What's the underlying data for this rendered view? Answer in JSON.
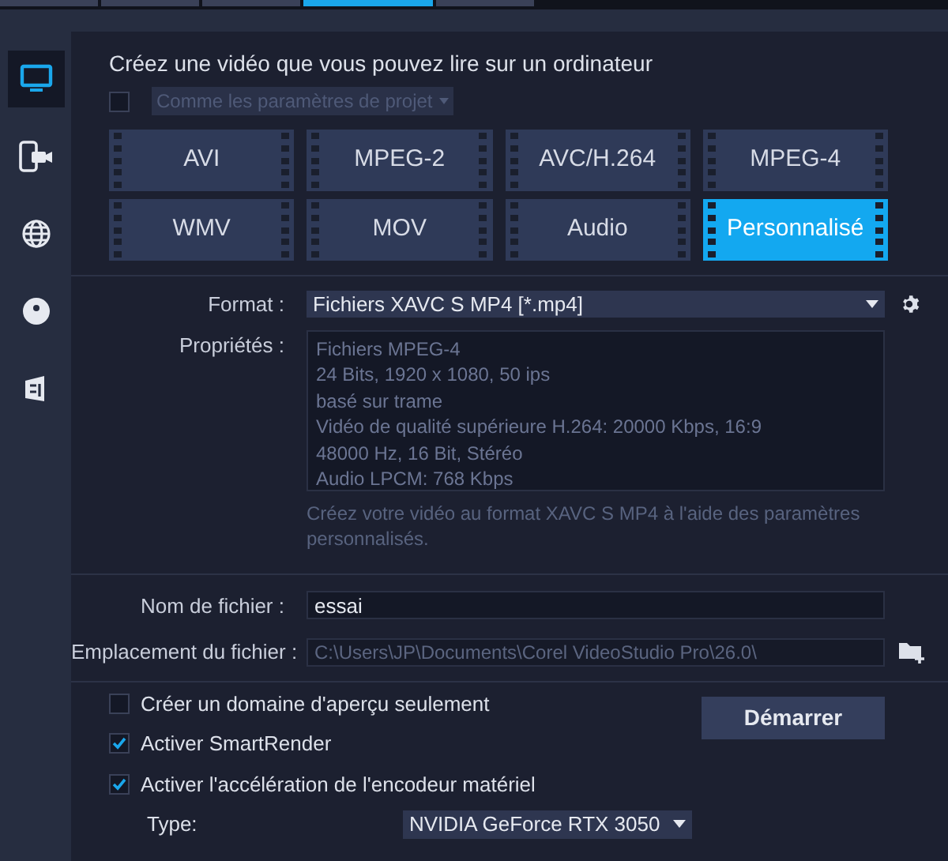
{
  "top_tabs": [
    {
      "selected": false
    },
    {
      "selected": false
    },
    {
      "selected": false
    },
    {
      "selected": true
    },
    {
      "selected": false
    }
  ],
  "sidebar": [
    {
      "kind": "computer",
      "selected": true
    },
    {
      "kind": "device",
      "selected": false
    },
    {
      "kind": "web",
      "selected": false
    },
    {
      "kind": "disc",
      "selected": false
    },
    {
      "kind": "stereo",
      "selected": false
    }
  ],
  "heading": "Créez une vidéo que vous pouvez lire sur un ordinateur",
  "project_settings": {
    "checked": false,
    "label": "Comme les paramètres de projet",
    "disabled": true
  },
  "formats": [
    {
      "label": "AVI",
      "selected": false
    },
    {
      "label": "MPEG-2",
      "selected": false
    },
    {
      "label": "AVC/H.264",
      "selected": false
    },
    {
      "label": "MPEG-4",
      "selected": false
    },
    {
      "label": "WMV",
      "selected": false
    },
    {
      "label": "MOV",
      "selected": false
    },
    {
      "label": "Audio",
      "selected": false
    },
    {
      "label": "Personnalisé",
      "selected": true
    }
  ],
  "format": {
    "label": "Format :",
    "value": "Fichiers XAVC S MP4 [*.mp4]"
  },
  "properties": {
    "label": "Propriétés :",
    "lines": [
      "Fichiers MPEG-4",
      "24 Bits, 1920 x 1080, 50 ips",
      "basé sur trame",
      "Vidéo de qualité supérieure H.264: 20000 Kbps, 16:9",
      "48000 Hz, 16 Bit, Stéréo",
      "Audio LPCM: 768 Kbps"
    ]
  },
  "description": "Créez votre vidéo au format XAVC S MP4 à l'aide des paramètres personnalisés.",
  "file_name": {
    "label": "Nom de fichier :",
    "value": "essai"
  },
  "file_location": {
    "label": "Emplacement du fichier :",
    "value": "C:\\Users\\JP\\Documents\\Corel VideoStudio Pro\\26.0\\"
  },
  "options": [
    {
      "label": "Créer un domaine d'aperçu seulement",
      "checked": false
    },
    {
      "label": "Activer SmartRender",
      "checked": true
    },
    {
      "label": "Activer l'accélération de l'encodeur matériel",
      "checked": true
    }
  ],
  "start_button": "Démarrer",
  "type": {
    "label": "Type:",
    "value": "NVIDIA GeForce RTX 3050"
  }
}
